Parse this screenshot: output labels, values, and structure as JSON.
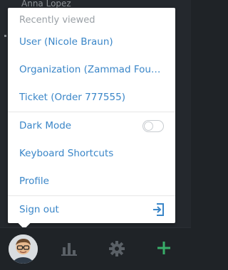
{
  "background": {
    "sidebar_user_name": "Anna Lopez"
  },
  "popover": {
    "section_header": "Recently viewed",
    "recent_items": [
      {
        "label": "User (Nicole Braun)"
      },
      {
        "label": "Organization (Zammad Found..."
      },
      {
        "label": "Ticket (Order 777555)"
      }
    ],
    "menu_items": [
      {
        "label": "Dark Mode",
        "toggle": {
          "on": false
        }
      },
      {
        "label": "Keyboard Shortcuts"
      },
      {
        "label": "Profile"
      }
    ],
    "sign_out_label": "Sign out"
  },
  "bottom_bar": {
    "icons": [
      "avatar",
      "stats-icon",
      "gear-icon",
      "plus-icon"
    ]
  },
  "colors": {
    "link": "#3a86c8",
    "muted": "#9aa0a6",
    "dark_bg": "#1f2327",
    "accent_green": "#38ad69",
    "icon_gray": "#5a6066"
  }
}
